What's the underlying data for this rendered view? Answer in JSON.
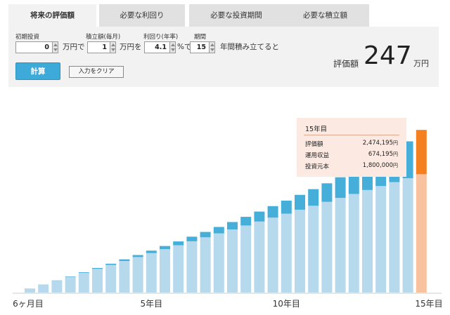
{
  "tabs": [
    {
      "label": "将来の評価額",
      "active": true
    },
    {
      "label": "必要な利回り",
      "active": false
    },
    {
      "label": "必要な投資期間",
      "active": false
    },
    {
      "label": "必要な積立額",
      "active": false
    }
  ],
  "form": {
    "initial": {
      "label": "初期投資",
      "value": "0",
      "unit": "万円で"
    },
    "monthly": {
      "label": "積立額(毎月)",
      "value": "1",
      "unit": "万円を"
    },
    "rate": {
      "label": "利回り(年率)",
      "value": "4.1",
      "unit": "%で"
    },
    "period": {
      "label": "期間",
      "value": "15",
      "unit": "年間積み立てると"
    },
    "calc_label": "計算",
    "clear_label": "入力をクリア"
  },
  "result": {
    "label": "評価額",
    "value": "247",
    "unit": "万円"
  },
  "tooltip": {
    "title": "15年目",
    "rows": [
      {
        "label": "評価額",
        "value": "2,474,195",
        "unit": "円"
      },
      {
        "label": "運用収益",
        "value": "674,195",
        "unit": "円"
      },
      {
        "label": "投資元本",
        "value": "1,800,000",
        "unit": "円"
      }
    ]
  },
  "colors": {
    "principal": "#b6d9ee",
    "gain": "#45afd9",
    "principal_highlight": "#f8c29f",
    "gain_highlight": "#f5801f",
    "tab_active": "#f2f2f2",
    "tab_inactive": "#e1e1e1",
    "calc_button": "#3daad9"
  },
  "chart_data": {
    "type": "bar",
    "stacked": true,
    "tick_labels": [
      "6ヶ月目",
      "5年目",
      "10年目",
      "15年目"
    ],
    "tick_indices": [
      0,
      9,
      19,
      29
    ],
    "half_years": [
      0.5,
      1,
      1.5,
      2,
      2.5,
      3,
      3.5,
      4,
      4.5,
      5,
      5.5,
      6,
      6.5,
      7,
      7.5,
      8,
      8.5,
      9,
      9.5,
      10,
      10.5,
      11,
      11.5,
      12,
      12.5,
      13,
      13.5,
      14,
      14.5,
      15
    ],
    "principal": [
      6,
      12,
      18,
      24,
      30,
      36,
      42,
      48,
      54,
      60,
      66,
      72,
      78,
      84,
      90,
      96,
      102,
      108,
      114,
      120,
      126,
      132,
      138,
      144,
      150,
      156,
      162,
      168,
      174,
      180
    ],
    "gain": [
      0.1,
      0.2,
      0.4,
      0.6,
      1.0,
      1.4,
      1.9,
      2.5,
      3.1,
      3.8,
      4.8,
      5.8,
      7.0,
      8.2,
      9.8,
      11.3,
      13.2,
      15.2,
      17.5,
      19.8,
      22.6,
      25.3,
      28.2,
      31.4,
      35.1,
      38.9,
      43.5,
      48.5,
      56.0,
      67.4
    ],
    "ylim": [
      0,
      260
    ],
    "highlight_index": 29
  }
}
